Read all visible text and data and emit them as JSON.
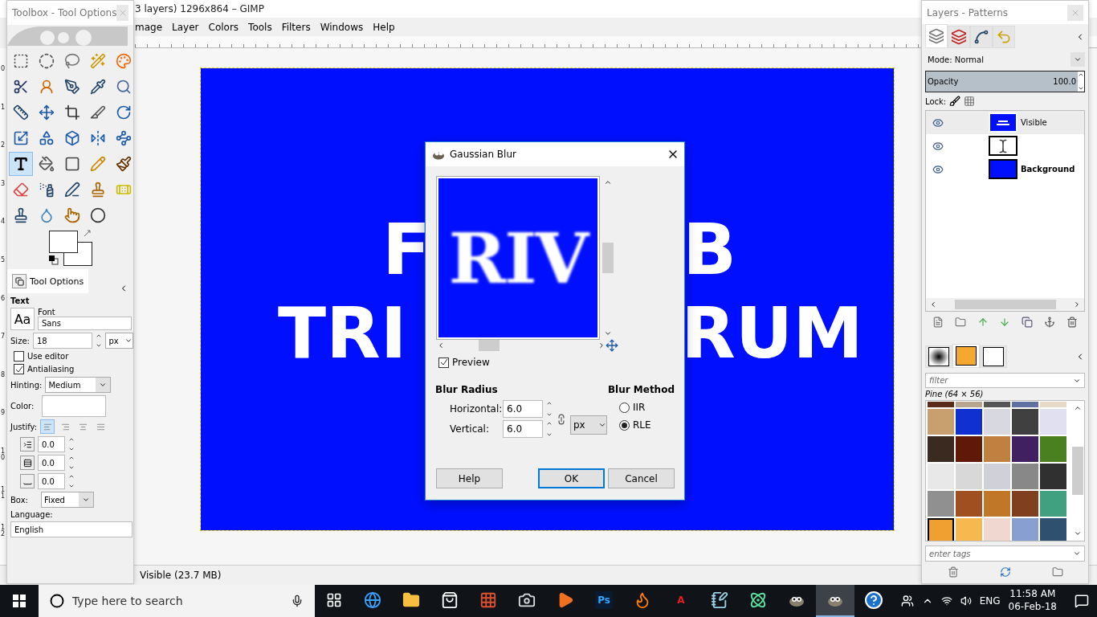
{
  "main_window": {
    "title": "3 layers) 1296x864 – GIMP",
    "menu": [
      "mage",
      "Layer",
      "Colors",
      "Tools",
      "Filters",
      "Windows",
      "Help"
    ],
    "left_ruler": [
      "0",
      "1",
      "2",
      "3",
      "4",
      "5",
      "6",
      "7",
      "8",
      "9",
      "10",
      "11",
      "12"
    ],
    "canvas_text": [
      "F",
      "B",
      "TRI",
      "RUM"
    ],
    "status": "Visible (23.7 MB)"
  },
  "toolbox": {
    "title": "Toolbox - Tool Options",
    "tools": [
      {
        "selected": false
      },
      {
        "selected": false
      },
      {
        "selected": false
      },
      {
        "selected": false
      },
      {
        "selected": false
      },
      {
        "selected": false
      },
      {
        "selected": false
      },
      {
        "selected": false
      },
      {
        "selected": false
      },
      {
        "selected": false
      },
      {
        "selected": false
      },
      {
        "selected": false
      },
      {
        "selected": false
      },
      {
        "selected": false
      },
      {
        "selected": false
      },
      {
        "selected": false
      },
      {
        "selected": false
      },
      {
        "selected": false
      },
      {
        "selected": false
      },
      {
        "selected": false
      },
      {
        "selected": true
      },
      {
        "selected": false
      },
      {
        "selected": false
      },
      {
        "selected": false
      },
      {
        "selected": false
      },
      {
        "selected": false
      },
      {
        "selected": false
      },
      {
        "selected": false
      },
      {
        "selected": false
      },
      {
        "selected": false
      },
      {
        "selected": false
      },
      {
        "selected": false
      },
      {
        "selected": false
      },
      {
        "selected": false
      }
    ]
  },
  "tool_options": {
    "tab": "Tool Options",
    "tool_name": "Text",
    "font_label": "Font",
    "font_preview": "Aa",
    "font": "Sans",
    "size_label": "Size:",
    "size": "18",
    "size_unit": "px",
    "checkboxes": [
      {
        "label": "Use editor",
        "checked": false
      },
      {
        "label": "Antialiasing",
        "checked": true
      }
    ],
    "hinting_label": "Hinting:",
    "hinting": "Medium",
    "color_label": "Color:",
    "justify_label": "Justify:",
    "justify": [
      {
        "selected": true
      },
      {
        "selected": false
      },
      {
        "selected": false
      },
      {
        "selected": false
      }
    ],
    "spacing": [
      "0.0",
      "0.0",
      "0.0"
    ],
    "box_label": "Box:",
    "box": "Fixed",
    "language_label": "Language:",
    "language": "English"
  },
  "layers_panel": {
    "title": "Layers - Patterns",
    "tabs": [
      {
        "selected": true
      },
      {
        "selected": false
      },
      {
        "selected": false
      },
      {
        "selected": false
      }
    ],
    "mode": "Mode: Normal",
    "opacity": {
      "label": "Opacity",
      "reading": "100.0",
      "level": 1
    },
    "lock_label": "Lock:",
    "layers": [
      {
        "name": "Visible",
        "kind": "image",
        "selected": true,
        "visible": true,
        "alpha": true
      },
      {
        "kind": "text",
        "selected": false,
        "visible": true
      },
      {
        "name": "Background",
        "kind": "fill",
        "selected": false,
        "visible": true,
        "alpha": false
      }
    ],
    "dockables": [
      {
        "kind": "brush",
        "selected": false
      },
      {
        "kind": "pattern",
        "selected": true
      },
      {
        "kind": "gradient",
        "selected": false
      }
    ],
    "filter_placeholder": "filter",
    "pattern_name": "Pine (64 × 56)",
    "patterns": [
      {
        "color": "#5a2a1a",
        "selected": false
      },
      {
        "color": "#b8a590",
        "selected": false
      },
      {
        "color": "#555555",
        "selected": false
      },
      {
        "color": "#6070a0",
        "selected": false
      },
      {
        "color": "#e8d8c8",
        "selected": false
      },
      {
        "color": "#c8a070",
        "selected": false
      },
      {
        "color": "#1030d0",
        "selected": false
      },
      {
        "color": "#d8d8e0",
        "selected": false
      },
      {
        "color": "#404040",
        "selected": false
      },
      {
        "color": "#e0e0f0",
        "selected": false
      },
      {
        "color": "#3a2a20",
        "selected": false
      },
      {
        "color": "#601808",
        "selected": false
      },
      {
        "color": "#c08040",
        "selected": false
      },
      {
        "color": "#402060",
        "selected": false
      },
      {
        "color": "#4a8020",
        "selected": false
      },
      {
        "color": "#e8e8e8",
        "selected": false
      },
      {
        "color": "#d8d8d8",
        "selected": false
      },
      {
        "color": "#d0d0d8",
        "selected": false
      },
      {
        "color": "#888888",
        "selected": false
      },
      {
        "color": "#303030",
        "selected": false
      },
      {
        "color": "#909090",
        "selected": false
      },
      {
        "color": "#a05020",
        "selected": false
      },
      {
        "color": "#c07828",
        "selected": false
      },
      {
        "color": "#804020",
        "selected": false
      },
      {
        "color": "#40a080",
        "selected": false
      },
      {
        "color": "#f0a030",
        "selected": true
      },
      {
        "color": "#f8b850",
        "selected": false
      },
      {
        "color": "#f0d8d0",
        "selected": false
      },
      {
        "color": "#88a0d0",
        "selected": false
      },
      {
        "color": "#305070",
        "selected": false
      }
    ],
    "tags_placeholder": "enter tags"
  },
  "dialog": {
    "title": "Gaussian Blur",
    "preview_text": "RIV",
    "preview": {
      "label": "Preview",
      "checked": true
    },
    "blur_radius": {
      "heading": "Blur Radius",
      "fields": [
        {
          "label": "Horizontal:",
          "value": "6.0"
        },
        {
          "label": "Vertical:",
          "value": "6.0"
        }
      ],
      "unit": "px",
      "chained": true
    },
    "blur_method": {
      "heading": "Blur Method",
      "options": [
        {
          "label": "IIR",
          "selected": false
        },
        {
          "label": "RLE",
          "selected": true
        }
      ]
    },
    "buttons": [
      {
        "label": "Help",
        "default": false
      },
      {
        "label": "OK",
        "default": true
      },
      {
        "label": "Cancel",
        "default": false
      }
    ]
  },
  "taskbar": {
    "search_placeholder": "Type here to search",
    "apps": [
      {
        "kind": "task-view",
        "active": false
      },
      {
        "kind": "edge",
        "active": false
      },
      {
        "kind": "folder",
        "active": false
      },
      {
        "kind": "store",
        "active": false
      },
      {
        "kind": "tiles",
        "active": false
      },
      {
        "kind": "camera",
        "active": false
      },
      {
        "kind": "player",
        "active": false
      },
      {
        "kind": "photoshop",
        "label": "Ps",
        "active": false
      },
      {
        "kind": "firefox",
        "active": false
      },
      {
        "kind": "autocad",
        "label": "A",
        "active": false
      },
      {
        "kind": "notebook",
        "active": false
      },
      {
        "kind": "atom",
        "active": false
      },
      {
        "kind": "gimp",
        "active": false
      },
      {
        "kind": "gimp",
        "active": true
      },
      {
        "kind": "help",
        "active": false
      }
    ],
    "language": "ENG",
    "time": "11:58 AM",
    "date": "06-Feb-18"
  }
}
